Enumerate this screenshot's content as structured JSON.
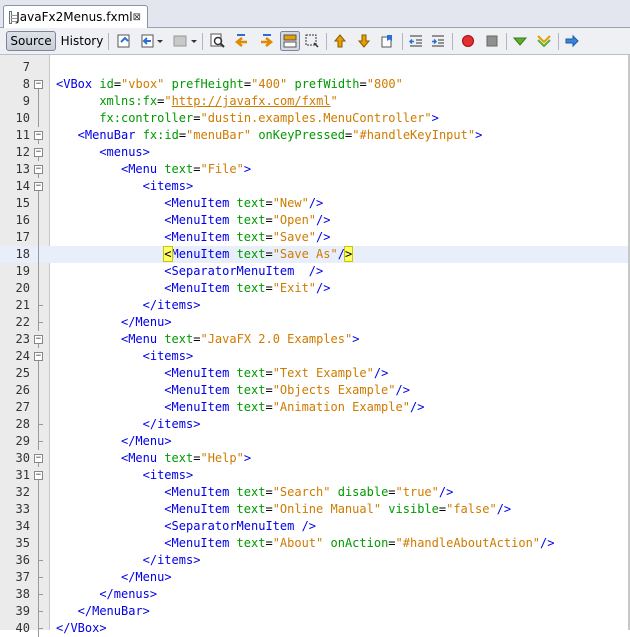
{
  "tab": {
    "title": "JavaFx2Menus.fxml",
    "close": "⊠"
  },
  "toolbar": {
    "source_label": "Source",
    "history_label": "History"
  },
  "colors": {
    "tag": "#0000e6",
    "attribute": "#009900",
    "value": "#ce7b00"
  },
  "current_line": 18,
  "lines": [
    {
      "n": "7",
      "fold": "",
      "indent": 0,
      "tokens": []
    },
    {
      "n": "8",
      "fold": "open",
      "indent": 0,
      "tokens": [
        [
          "tag",
          "<VBox "
        ],
        [
          "attr",
          "id"
        ],
        [
          "plain",
          "="
        ],
        [
          "val",
          "\"vbox\""
        ],
        [
          "plain",
          " "
        ],
        [
          "attr",
          "prefHeight"
        ],
        [
          "plain",
          "="
        ],
        [
          "val",
          "\"400\""
        ],
        [
          "plain",
          " "
        ],
        [
          "attr",
          "prefWidth"
        ],
        [
          "plain",
          "="
        ],
        [
          "val",
          "\"800\""
        ]
      ]
    },
    {
      "n": "9",
      "fold": "line",
      "indent": 6,
      "tokens": [
        [
          "attr",
          "xmlns:fx"
        ],
        [
          "plain",
          "="
        ],
        [
          "val",
          "\""
        ],
        [
          "url",
          "http://javafx.com/fxml"
        ],
        [
          "val",
          "\""
        ]
      ]
    },
    {
      "n": "10",
      "fold": "line",
      "indent": 6,
      "tokens": [
        [
          "attr",
          "fx:controller"
        ],
        [
          "plain",
          "="
        ],
        [
          "val",
          "\"dustin.examples.MenuController\""
        ],
        [
          "tag",
          ">"
        ]
      ]
    },
    {
      "n": "11",
      "fold": "open",
      "indent": 3,
      "tokens": [
        [
          "tag",
          "<MenuBar "
        ],
        [
          "attr",
          "fx:id"
        ],
        [
          "plain",
          "="
        ],
        [
          "val",
          "\"menuBar\""
        ],
        [
          "plain",
          " "
        ],
        [
          "attr",
          "onKeyPressed"
        ],
        [
          "plain",
          "="
        ],
        [
          "val",
          "\"#handleKeyInput\""
        ],
        [
          "tag",
          ">"
        ]
      ]
    },
    {
      "n": "12",
      "fold": "open",
      "indent": 6,
      "tokens": [
        [
          "tag",
          "<menus>"
        ]
      ]
    },
    {
      "n": "13",
      "fold": "open",
      "indent": 9,
      "tokens": [
        [
          "tag",
          "<Menu "
        ],
        [
          "attr",
          "text"
        ],
        [
          "plain",
          "="
        ],
        [
          "val",
          "\"File\""
        ],
        [
          "tag",
          ">"
        ]
      ]
    },
    {
      "n": "14",
      "fold": "open",
      "indent": 12,
      "tokens": [
        [
          "tag",
          "<items>"
        ]
      ]
    },
    {
      "n": "15",
      "fold": "line",
      "indent": 15,
      "tokens": [
        [
          "tag",
          "<MenuItem "
        ],
        [
          "attr",
          "text"
        ],
        [
          "plain",
          "="
        ],
        [
          "val",
          "\"New\""
        ],
        [
          "tag",
          "/>"
        ]
      ]
    },
    {
      "n": "16",
      "fold": "line",
      "indent": 15,
      "tokens": [
        [
          "tag",
          "<MenuItem "
        ],
        [
          "attr",
          "text"
        ],
        [
          "plain",
          "="
        ],
        [
          "val",
          "\"Open\""
        ],
        [
          "tag",
          "/>"
        ]
      ]
    },
    {
      "n": "17",
      "fold": "line",
      "indent": 15,
      "tokens": [
        [
          "tag",
          "<MenuItem "
        ],
        [
          "attr",
          "text"
        ],
        [
          "plain",
          "="
        ],
        [
          "val",
          "\"Save\""
        ],
        [
          "tag",
          "/>"
        ]
      ]
    },
    {
      "n": "18",
      "fold": "line",
      "indent": 15,
      "tokens": [
        [
          "brk",
          "<"
        ],
        [
          "tag",
          "MenuItem "
        ],
        [
          "attr",
          "text"
        ],
        [
          "plain",
          "="
        ],
        [
          "val",
          "\"Save As\""
        ],
        [
          "tag",
          "/"
        ],
        [
          "brk",
          ">"
        ]
      ]
    },
    {
      "n": "19",
      "fold": "line",
      "indent": 15,
      "tokens": [
        [
          "tag",
          "<SeparatorMenuItem  />"
        ]
      ]
    },
    {
      "n": "20",
      "fold": "line",
      "indent": 15,
      "tokens": [
        [
          "tag",
          "<MenuItem "
        ],
        [
          "attr",
          "text"
        ],
        [
          "plain",
          "="
        ],
        [
          "val",
          "\"Exit\""
        ],
        [
          "tag",
          "/>"
        ]
      ]
    },
    {
      "n": "21",
      "fold": "end",
      "indent": 12,
      "tokens": [
        [
          "tag",
          "</items>"
        ]
      ]
    },
    {
      "n": "22",
      "fold": "end",
      "indent": 9,
      "tokens": [
        [
          "tag",
          "</Menu>"
        ]
      ]
    },
    {
      "n": "23",
      "fold": "open",
      "indent": 9,
      "tokens": [
        [
          "tag",
          "<Menu "
        ],
        [
          "attr",
          "text"
        ],
        [
          "plain",
          "="
        ],
        [
          "val",
          "\"JavaFX 2.0 Examples\""
        ],
        [
          "tag",
          ">"
        ]
      ]
    },
    {
      "n": "24",
      "fold": "open",
      "indent": 12,
      "tokens": [
        [
          "tag",
          "<items>"
        ]
      ]
    },
    {
      "n": "25",
      "fold": "line",
      "indent": 15,
      "tokens": [
        [
          "tag",
          "<MenuItem "
        ],
        [
          "attr",
          "text"
        ],
        [
          "plain",
          "="
        ],
        [
          "val",
          "\"Text Example\""
        ],
        [
          "tag",
          "/>"
        ]
      ]
    },
    {
      "n": "26",
      "fold": "line",
      "indent": 15,
      "tokens": [
        [
          "tag",
          "<MenuItem "
        ],
        [
          "attr",
          "text"
        ],
        [
          "plain",
          "="
        ],
        [
          "val",
          "\"Objects Example\""
        ],
        [
          "tag",
          "/>"
        ]
      ]
    },
    {
      "n": "27",
      "fold": "line",
      "indent": 15,
      "tokens": [
        [
          "tag",
          "<MenuItem "
        ],
        [
          "attr",
          "text"
        ],
        [
          "plain",
          "="
        ],
        [
          "val",
          "\"Animation Example\""
        ],
        [
          "tag",
          "/>"
        ]
      ]
    },
    {
      "n": "28",
      "fold": "end",
      "indent": 12,
      "tokens": [
        [
          "tag",
          "</items>"
        ]
      ]
    },
    {
      "n": "29",
      "fold": "end",
      "indent": 9,
      "tokens": [
        [
          "tag",
          "</Menu>"
        ]
      ]
    },
    {
      "n": "30",
      "fold": "open",
      "indent": 9,
      "tokens": [
        [
          "tag",
          "<Menu "
        ],
        [
          "attr",
          "text"
        ],
        [
          "plain",
          "="
        ],
        [
          "val",
          "\"Help\""
        ],
        [
          "tag",
          ">"
        ]
      ]
    },
    {
      "n": "31",
      "fold": "open",
      "indent": 12,
      "tokens": [
        [
          "tag",
          "<items>"
        ]
      ]
    },
    {
      "n": "32",
      "fold": "line",
      "indent": 15,
      "tokens": [
        [
          "tag",
          "<MenuItem "
        ],
        [
          "attr",
          "text"
        ],
        [
          "plain",
          "="
        ],
        [
          "val",
          "\"Search\""
        ],
        [
          "plain",
          " "
        ],
        [
          "attr",
          "disable"
        ],
        [
          "plain",
          "="
        ],
        [
          "val",
          "\"true\""
        ],
        [
          "tag",
          "/>"
        ]
      ]
    },
    {
      "n": "33",
      "fold": "line",
      "indent": 15,
      "tokens": [
        [
          "tag",
          "<MenuItem "
        ],
        [
          "attr",
          "text"
        ],
        [
          "plain",
          "="
        ],
        [
          "val",
          "\"Online Manual\""
        ],
        [
          "plain",
          " "
        ],
        [
          "attr",
          "visible"
        ],
        [
          "plain",
          "="
        ],
        [
          "val",
          "\"false\""
        ],
        [
          "tag",
          "/>"
        ]
      ]
    },
    {
      "n": "34",
      "fold": "line",
      "indent": 15,
      "tokens": [
        [
          "tag",
          "<SeparatorMenuItem />"
        ]
      ]
    },
    {
      "n": "35",
      "fold": "line",
      "indent": 15,
      "tokens": [
        [
          "tag",
          "<MenuItem "
        ],
        [
          "attr",
          "text"
        ],
        [
          "plain",
          "="
        ],
        [
          "val",
          "\"About\""
        ],
        [
          "plain",
          " "
        ],
        [
          "attr",
          "onAction"
        ],
        [
          "plain",
          "="
        ],
        [
          "val",
          "\"#handleAboutAction\""
        ],
        [
          "tag",
          "/>"
        ]
      ]
    },
    {
      "n": "36",
      "fold": "end",
      "indent": 12,
      "tokens": [
        [
          "tag",
          "</items>"
        ]
      ]
    },
    {
      "n": "37",
      "fold": "end",
      "indent": 9,
      "tokens": [
        [
          "tag",
          "</Menu>"
        ]
      ]
    },
    {
      "n": "38",
      "fold": "end",
      "indent": 6,
      "tokens": [
        [
          "tag",
          "</menus>"
        ]
      ]
    },
    {
      "n": "39",
      "fold": "end",
      "indent": 3,
      "tokens": [
        [
          "tag",
          "</MenuBar>"
        ]
      ]
    },
    {
      "n": "40",
      "fold": "end",
      "indent": 0,
      "tokens": [
        [
          "tag",
          "</VBox>"
        ]
      ]
    }
  ]
}
